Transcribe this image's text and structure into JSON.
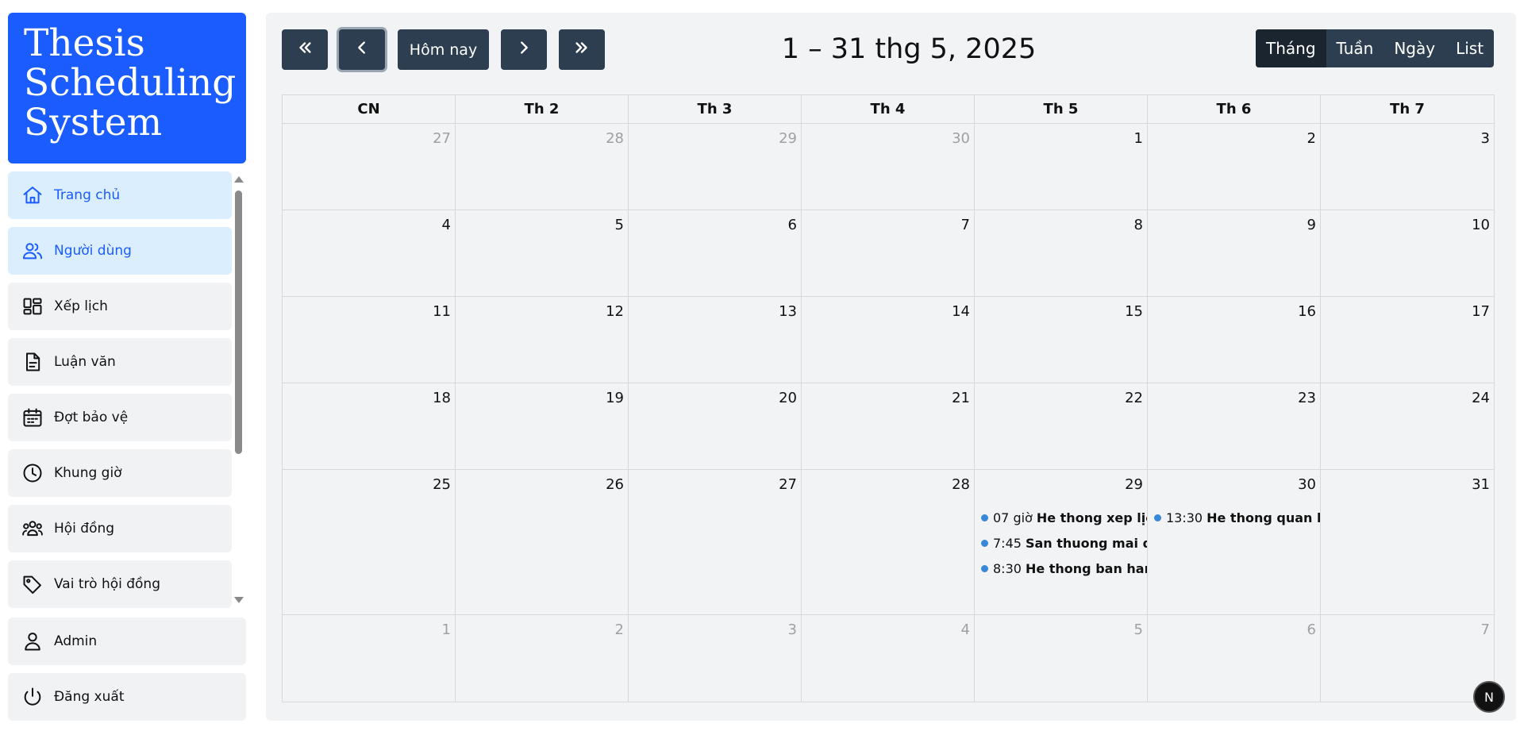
{
  "app": {
    "logo_text": "Thesis Scheduling System"
  },
  "sidebar": {
    "items": [
      {
        "label": "Trang chủ",
        "icon": "home-icon",
        "active": true
      },
      {
        "label": "Người dùng",
        "icon": "users-icon",
        "active": true
      },
      {
        "label": "Xếp lịch",
        "icon": "layout-icon",
        "active": false
      },
      {
        "label": "Luận văn",
        "icon": "document-icon",
        "active": false
      },
      {
        "label": "Đợt bảo vệ",
        "icon": "calendar-icon",
        "active": false
      },
      {
        "label": "Khung giờ",
        "icon": "clock-icon",
        "active": false
      },
      {
        "label": "Hội đồng",
        "icon": "group-icon",
        "active": false
      },
      {
        "label": "Vai trò hội đồng",
        "icon": "tag-icon",
        "active": false
      }
    ],
    "admin_label": "Admin",
    "logout_label": "Đăng xuất"
  },
  "toolbar": {
    "today_label": "Hôm nay",
    "title": "1 – 31 thg 5, 2025",
    "views": [
      {
        "label": "Tháng",
        "active": true
      },
      {
        "label": "Tuần",
        "active": false
      },
      {
        "label": "Ngày",
        "active": false
      },
      {
        "label": "List",
        "active": false
      }
    ]
  },
  "calendar": {
    "weekdays": [
      "CN",
      "Th 2",
      "Th 3",
      "Th 4",
      "Th 5",
      "Th 6",
      "Th 7"
    ],
    "weeks": [
      [
        {
          "day": "27",
          "other": true
        },
        {
          "day": "28",
          "other": true
        },
        {
          "day": "29",
          "other": true
        },
        {
          "day": "30",
          "other": true
        },
        {
          "day": "1"
        },
        {
          "day": "2"
        },
        {
          "day": "3"
        }
      ],
      [
        {
          "day": "4"
        },
        {
          "day": "5"
        },
        {
          "day": "6"
        },
        {
          "day": "7"
        },
        {
          "day": "8"
        },
        {
          "day": "9"
        },
        {
          "day": "10"
        }
      ],
      [
        {
          "day": "11"
        },
        {
          "day": "12"
        },
        {
          "day": "13"
        },
        {
          "day": "14"
        },
        {
          "day": "15"
        },
        {
          "day": "16"
        },
        {
          "day": "17"
        }
      ],
      [
        {
          "day": "18"
        },
        {
          "day": "19"
        },
        {
          "day": "20"
        },
        {
          "day": "21"
        },
        {
          "day": "22"
        },
        {
          "day": "23"
        },
        {
          "day": "24"
        }
      ],
      [
        {
          "day": "25"
        },
        {
          "day": "26"
        },
        {
          "day": "27"
        },
        {
          "day": "28"
        },
        {
          "day": "29",
          "events": [
            {
              "time": "07 giờ",
              "title": "He thong xep lịch"
            },
            {
              "time": "7:45",
              "title": "San thuong mai d"
            },
            {
              "time": "8:30",
              "title": "He thong ban han"
            }
          ]
        },
        {
          "day": "30",
          "events": [
            {
              "time": "13:30",
              "title": "He thong quan ly"
            }
          ]
        },
        {
          "day": "31"
        }
      ],
      [
        {
          "day": "1",
          "other": true
        },
        {
          "day": "2",
          "other": true
        },
        {
          "day": "3",
          "other": true
        },
        {
          "day": "4",
          "other": true
        },
        {
          "day": "5",
          "other": true
        },
        {
          "day": "6",
          "other": true
        },
        {
          "day": "7",
          "other": true
        }
      ]
    ],
    "event_dot_color": "#3788d8"
  },
  "badge": {
    "label": "N"
  },
  "colors": {
    "brand": "#1b5cff",
    "toolbar": "#2c3e50",
    "active_view": "#1a252f",
    "active_nav_bg": "#dbeefe"
  }
}
